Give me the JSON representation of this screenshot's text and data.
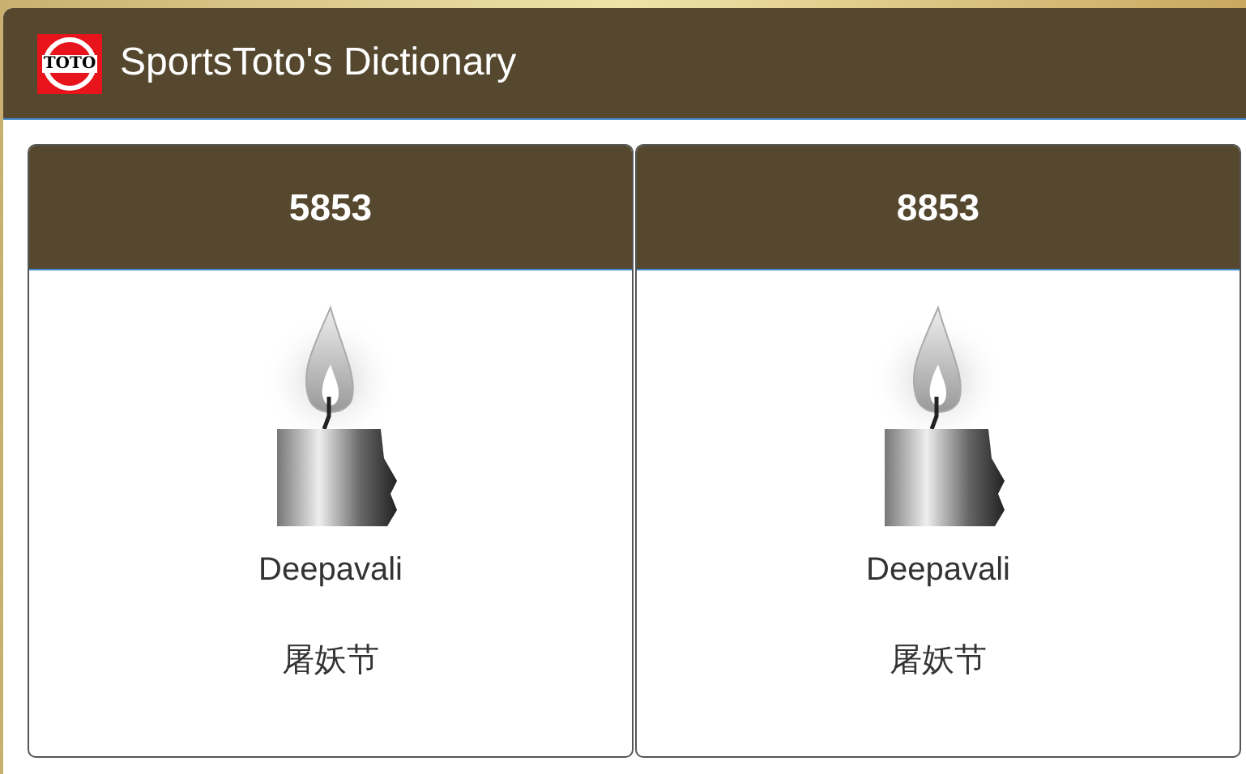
{
  "app_bar": {
    "logo_text": "TOTO",
    "title": "SportsToto's Dictionary"
  },
  "cards": [
    {
      "number": "5853",
      "name": "Deepavali",
      "name_zh": "屠妖节"
    },
    {
      "number": "8853",
      "name": "Deepavali",
      "name_zh": "屠妖节"
    }
  ]
}
